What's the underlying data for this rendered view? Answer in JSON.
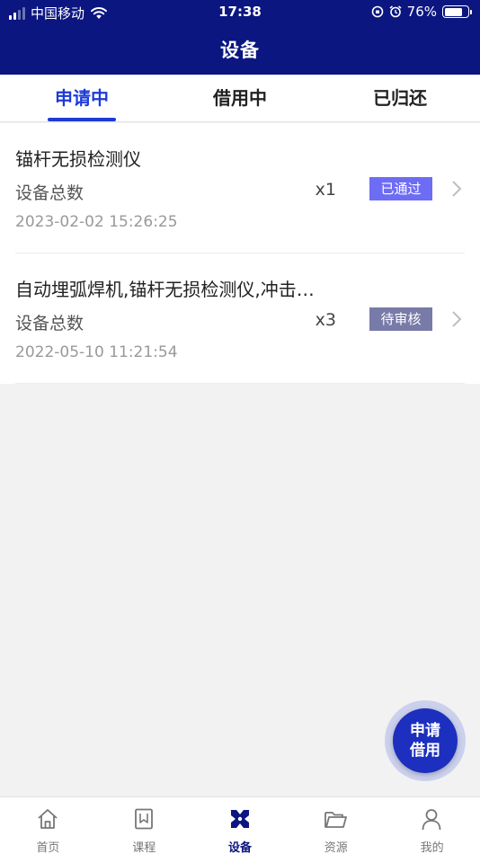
{
  "status_bar": {
    "carrier": "中国移动",
    "time": "17:38",
    "battery": "76%",
    "battery_level": 0.76
  },
  "header": {
    "title": "设备"
  },
  "tabs": [
    {
      "label": "申请中",
      "active": true
    },
    {
      "label": "借用中",
      "active": false
    },
    {
      "label": "已归还",
      "active": false
    }
  ],
  "items": [
    {
      "title": "锚杆无损检测仪",
      "total_label": "设备总数",
      "count": "x1",
      "status": "已通过",
      "status_color": "#6d6cf5",
      "date": "2023-02-02 15:26:25"
    },
    {
      "title": "自动埋弧焊机,锚杆无损检测仪,冲击…",
      "total_label": "设备总数",
      "count": "x3",
      "status": "待审核",
      "status_color": "#787aa8",
      "date": "2022-05-10 11:21:54"
    }
  ],
  "fab": {
    "line1": "申请",
    "line2": "借用"
  },
  "tabbar": [
    {
      "label": "首页",
      "icon": "home-icon",
      "active": false
    },
    {
      "label": "课程",
      "icon": "course-icon",
      "active": false
    },
    {
      "label": "设备",
      "icon": "device-icon",
      "active": true
    },
    {
      "label": "资源",
      "icon": "folder-icon",
      "active": false
    },
    {
      "label": "我的",
      "icon": "user-icon",
      "active": false
    }
  ],
  "colors": {
    "header_bg": "#0b1680",
    "accent": "#1d3bd6",
    "page_bg": "#f2f2f2"
  }
}
